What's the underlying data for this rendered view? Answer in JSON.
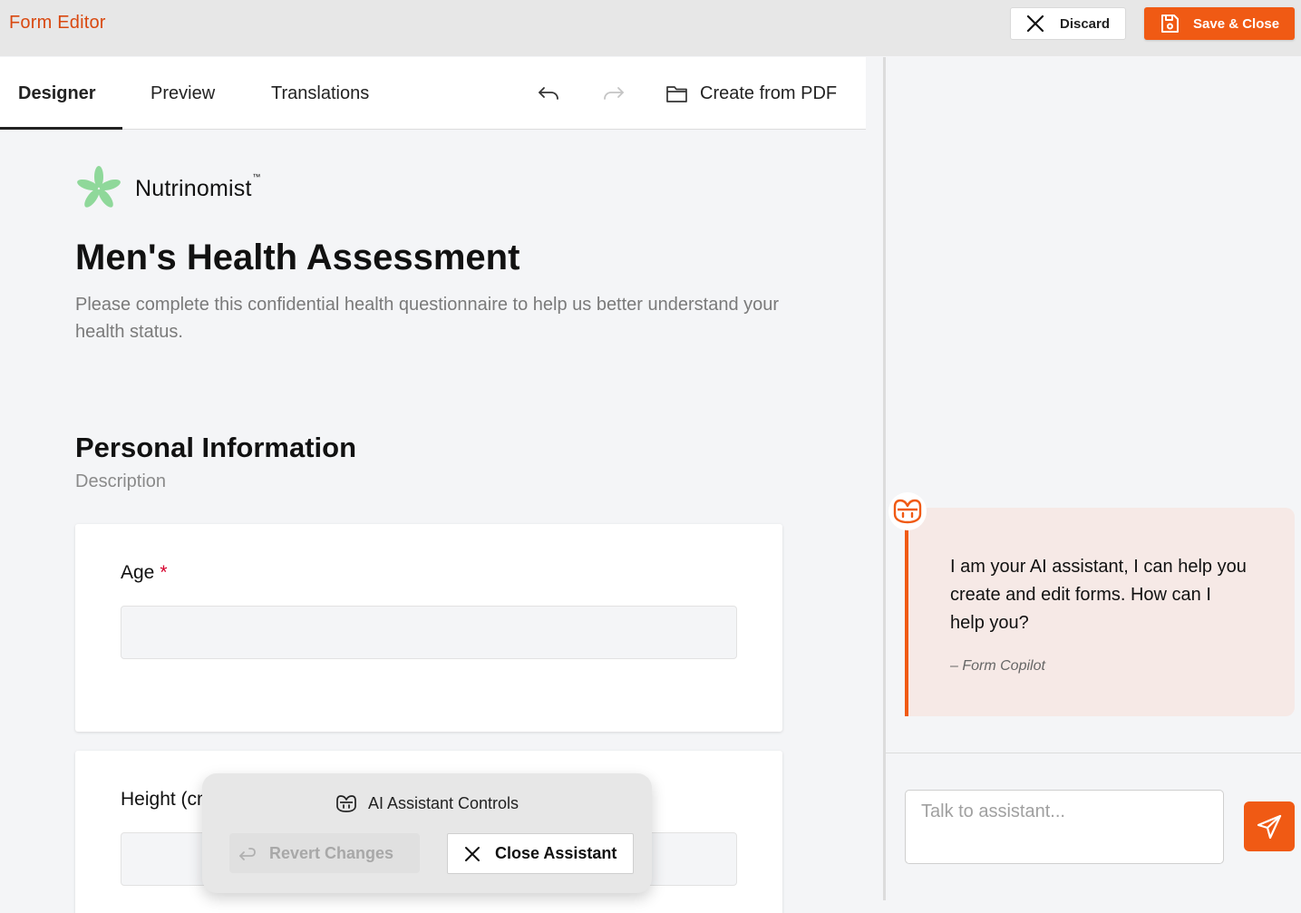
{
  "app": {
    "title": "Form Editor"
  },
  "toolbar": {
    "discard_label": "Discard",
    "save_label": "Save & Close"
  },
  "tabs": [
    {
      "label": "Designer",
      "active": true
    },
    {
      "label": "Preview",
      "active": false
    },
    {
      "label": "Translations",
      "active": false
    }
  ],
  "header_actions": {
    "undo_icon": "undo-icon",
    "redo_icon": "redo-icon",
    "create_pdf_label": "Create from PDF"
  },
  "form": {
    "logo_text": "Nutrinomist",
    "logo_tm": "™",
    "title": "Men's Health Assessment",
    "description": "Please complete this confidential health questionnaire to help us better understand your health status.",
    "section": {
      "title": "Personal Information",
      "description": "Description",
      "questions": [
        {
          "label": "Age",
          "required": true,
          "required_mark": "*",
          "value": ""
        },
        {
          "label": "Height (cm)",
          "required": false,
          "value": ""
        }
      ]
    }
  },
  "assistant": {
    "message": "I am your AI assistant, I can help you create and edit forms. How can I help you?",
    "author": "– Form Copilot",
    "input_placeholder": "Talk to assistant..."
  },
  "ai_controls": {
    "title": "AI Assistant Controls",
    "revert_label": "Revert Changes",
    "revert_enabled": false,
    "close_label": "Close Assistant"
  },
  "colors": {
    "accent": "#f05a14",
    "title": "#d9480f",
    "required": "#d6002c",
    "message_bg": "#f6e9e6"
  }
}
